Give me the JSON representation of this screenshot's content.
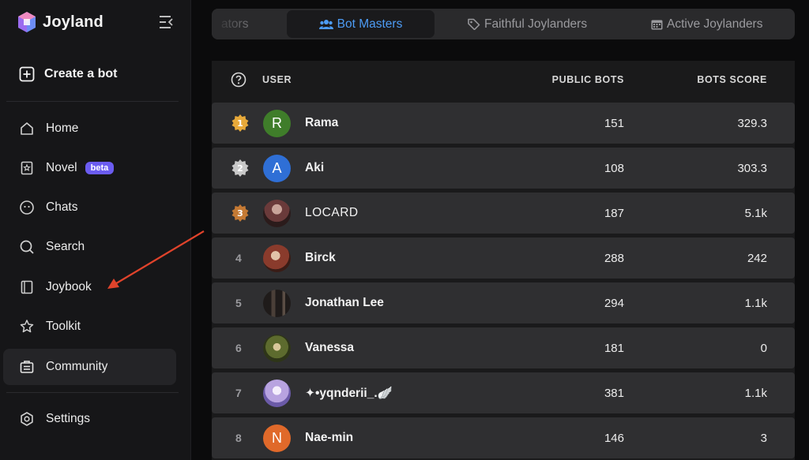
{
  "app": {
    "name": "Joyland"
  },
  "sidebar": {
    "create_bot": "Create a bot",
    "items": [
      {
        "label": "Home",
        "icon": "home-icon"
      },
      {
        "label": "Novel",
        "icon": "novel-icon",
        "badge": "beta"
      },
      {
        "label": "Chats",
        "icon": "chat-bubble-icon"
      },
      {
        "label": "Search",
        "icon": "search-icon"
      },
      {
        "label": "Joybook",
        "icon": "book-icon"
      },
      {
        "label": "Toolkit",
        "icon": "toolkit-icon"
      },
      {
        "label": "Community",
        "icon": "community-icon",
        "active": true
      },
      {
        "label": "Settings",
        "icon": "gear-icon"
      }
    ]
  },
  "tabs": [
    {
      "label": "ators",
      "icon": ""
    },
    {
      "label": "Bot Masters",
      "icon": "users-icon",
      "active": true
    },
    {
      "label": "Faithful Joylanders",
      "icon": "tag-icon"
    },
    {
      "label": "Active Joylanders",
      "icon": "calendar-icon"
    }
  ],
  "table": {
    "columns": {
      "user": "USER",
      "public_bots": "PUBLIC BOTS",
      "bots_score": "BOTS SCORE"
    },
    "rows": [
      {
        "rank": "1",
        "medal": "gold",
        "avatar_letter": "R",
        "avatar_color": "#3f7d2a",
        "name": "Rama",
        "public_bots": "151",
        "score": "329.3"
      },
      {
        "rank": "2",
        "medal": "silver",
        "avatar_letter": "A",
        "avatar_color": "#2f6fd6",
        "name": "Aki",
        "public_bots": "108",
        "score": "303.3"
      },
      {
        "rank": "3",
        "medal": "bronze",
        "avatar_letter": "",
        "avatar_color": "#6a3a3a",
        "name": "LOCARD",
        "public_bots": "187",
        "score": "5.1k"
      },
      {
        "rank": "4",
        "medal": "",
        "avatar_letter": "",
        "avatar_color": "#8a3b2c",
        "name": "Birck",
        "public_bots": "288",
        "score": "242"
      },
      {
        "rank": "5",
        "medal": "",
        "avatar_letter": "",
        "avatar_color": "#2d2a28",
        "name": "Jonathan Lee",
        "public_bots": "294",
        "score": "1.1k"
      },
      {
        "rank": "6",
        "medal": "",
        "avatar_letter": "",
        "avatar_color": "#5d6b2e",
        "name": "Vanessa",
        "public_bots": "181",
        "score": "0"
      },
      {
        "rank": "7",
        "medal": "",
        "avatar_letter": "",
        "avatar_color": "#b8a3e0",
        "name": "✦•yqnderii_.🪽",
        "public_bots": "381",
        "score": "1.1k"
      },
      {
        "rank": "8",
        "medal": "",
        "avatar_letter": "N",
        "avatar_color": "#e0692a",
        "name": "Nae-min",
        "public_bots": "146",
        "score": "3"
      }
    ]
  },
  "colors": {
    "accent": "#4d9cf5",
    "badge": "#6b5cf0",
    "arrow": "#e0432b"
  }
}
